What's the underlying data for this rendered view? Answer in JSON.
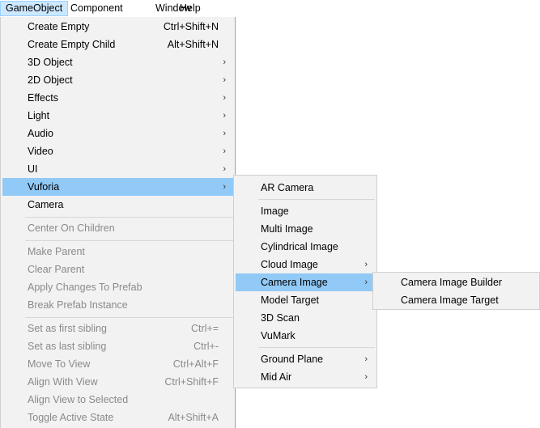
{
  "menubar": {
    "items": [
      {
        "label": "GameObject"
      },
      {
        "label": "Component"
      },
      {
        "label": "Window"
      },
      {
        "label": "Help"
      }
    ]
  },
  "main_menu": {
    "items": [
      {
        "label": "Create Empty",
        "shortcut": "Ctrl+Shift+N"
      },
      {
        "label": "Create Empty Child",
        "shortcut": "Alt+Shift+N"
      },
      {
        "label": "3D Object",
        "arrow": "›"
      },
      {
        "label": "2D Object",
        "arrow": "›"
      },
      {
        "label": "Effects",
        "arrow": "›"
      },
      {
        "label": "Light",
        "arrow": "›"
      },
      {
        "label": "Audio",
        "arrow": "›"
      },
      {
        "label": "Video",
        "arrow": "›"
      },
      {
        "label": "UI",
        "arrow": "›"
      },
      {
        "label": "Vuforia",
        "arrow": "›"
      },
      {
        "label": "Camera"
      },
      {
        "label": "Center On Children"
      },
      {
        "label": "Make Parent"
      },
      {
        "label": "Clear Parent"
      },
      {
        "label": "Apply Changes To Prefab"
      },
      {
        "label": "Break Prefab Instance"
      },
      {
        "label": "Set as first sibling",
        "shortcut": "Ctrl+="
      },
      {
        "label": "Set as last sibling",
        "shortcut": "Ctrl+-"
      },
      {
        "label": "Move To View",
        "shortcut": "Ctrl+Alt+F"
      },
      {
        "label": "Align With View",
        "shortcut": "Ctrl+Shift+F"
      },
      {
        "label": "Align View to Selected"
      },
      {
        "label": "Toggle Active State",
        "shortcut": "Alt+Shift+A"
      }
    ]
  },
  "vuforia_menu": {
    "items": [
      {
        "label": "AR Camera"
      },
      {
        "label": "Image"
      },
      {
        "label": "Multi Image"
      },
      {
        "label": "Cylindrical Image"
      },
      {
        "label": "Cloud Image",
        "arrow": "›"
      },
      {
        "label": "Camera Image",
        "arrow": "›"
      },
      {
        "label": "Model Target"
      },
      {
        "label": "3D Scan"
      },
      {
        "label": "VuMark"
      },
      {
        "label": "Ground Plane",
        "arrow": "›"
      },
      {
        "label": "Mid Air",
        "arrow": "›"
      }
    ]
  },
  "camera_image_menu": {
    "items": [
      {
        "label": "Camera Image Builder"
      },
      {
        "label": "Camera Image Target"
      }
    ]
  }
}
